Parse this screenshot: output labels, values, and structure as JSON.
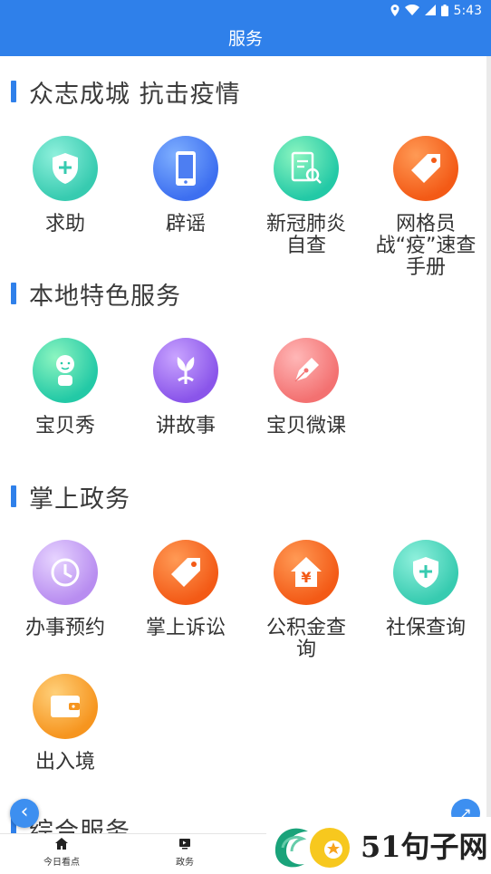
{
  "status_bar": {
    "time": "5:43",
    "icons": [
      "location-icon",
      "wifi-icon",
      "signal-icon",
      "battery-icon"
    ]
  },
  "header": {
    "title": "服务"
  },
  "sections": [
    {
      "title": "众志成城 抗击疫情",
      "items": [
        {
          "label": "求助",
          "icon": "shield-plus-icon"
        },
        {
          "label": "辟谣",
          "icon": "phone-icon"
        },
        {
          "label": "新冠肺炎\n自查",
          "icon": "document-search-icon"
        },
        {
          "label": "网格员\n战“疫”速查\n手册",
          "icon": "tag-icon"
        }
      ]
    },
    {
      "title": "本地特色服务",
      "items": [
        {
          "label": "宝贝秀",
          "icon": "baby-icon"
        },
        {
          "label": "讲故事",
          "icon": "flower-icon"
        },
        {
          "label": "宝贝微课",
          "icon": "pen-icon"
        }
      ]
    },
    {
      "title": "掌上政务",
      "items": [
        {
          "label": "办事预约",
          "icon": "clock-icon"
        },
        {
          "label": "掌上诉讼",
          "icon": "tag-icon"
        },
        {
          "label": "公积金查\n询",
          "icon": "house-yuan-icon"
        },
        {
          "label": "社保查询",
          "icon": "shield-plus-icon"
        },
        {
          "label": "出入境",
          "icon": "wallet-icon"
        }
      ]
    },
    {
      "title": "综合服务",
      "items": []
    }
  ],
  "tab_bar": [
    {
      "label": "今日看点",
      "icon": "home-icon"
    },
    {
      "label": "政务",
      "icon": "tv-icon"
    }
  ],
  "watermark": {
    "text": "51句子网"
  },
  "colors": {
    "accent": "#2f80ea"
  }
}
